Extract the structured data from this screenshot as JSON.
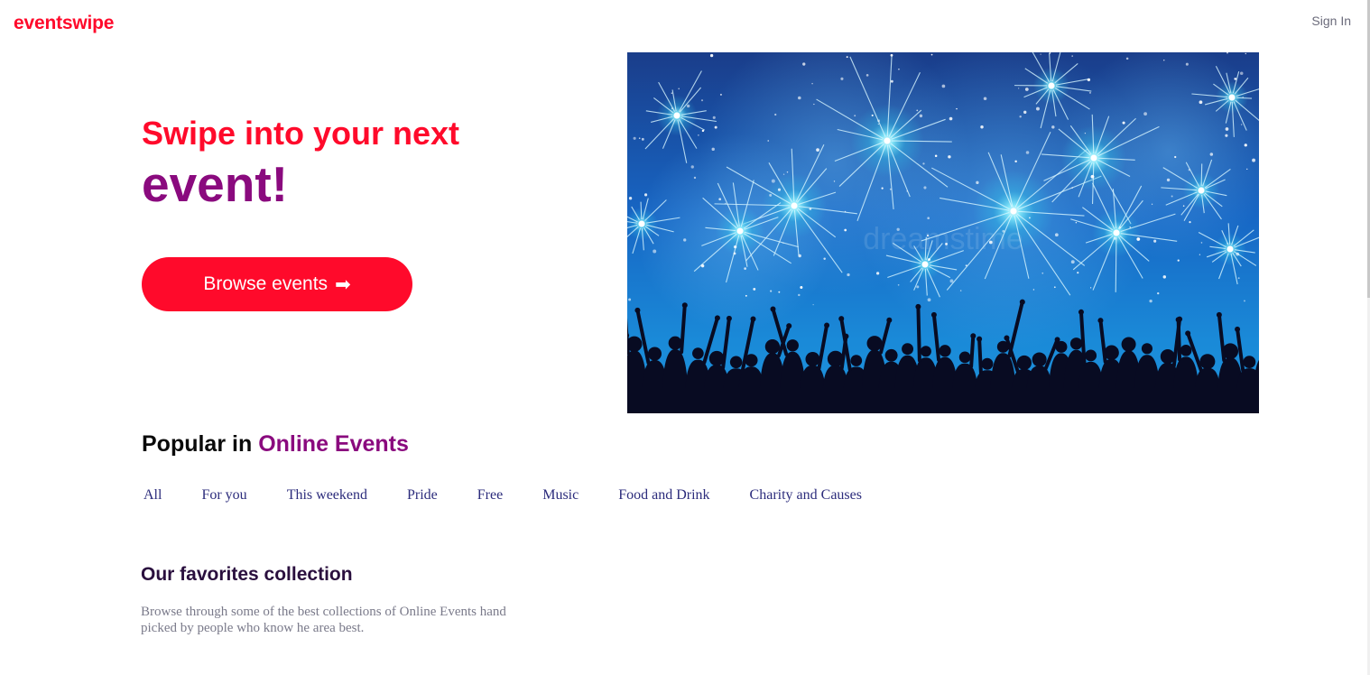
{
  "header": {
    "logo": "eventswipe",
    "signin_label": "Sign In"
  },
  "hero": {
    "line1": "Swipe into your next",
    "line2": "event!",
    "button_label": "Browse events",
    "button_arrow": "➡",
    "image_watermark": "dreamstime"
  },
  "popular": {
    "prefix": "Popular in",
    "highlight": "Online Events",
    "tabs": [
      "All",
      "For you",
      "This weekend",
      "Pride",
      "Free",
      "Music",
      "Food and Drink",
      "Charity and Causes"
    ]
  },
  "favorites": {
    "title": "Our favorites collection",
    "description": "Browse through some of the best collections of Online Events hand picked by people who know he area best."
  },
  "colors": {
    "brand_red": "#ff0a2b",
    "brand_purple": "#8a0a7e",
    "tab_text": "#2c2c7c"
  }
}
